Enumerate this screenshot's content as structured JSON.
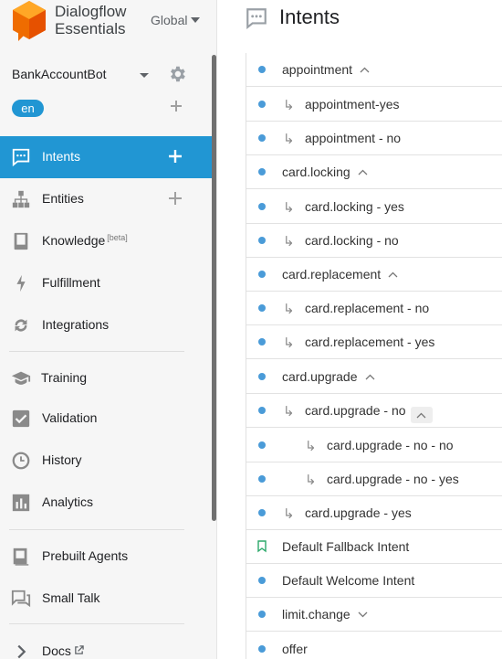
{
  "app": {
    "brand_line1": "Dialogflow",
    "brand_line2": "Essentials",
    "region": "Global"
  },
  "agent": {
    "name": "BankAccountBot",
    "language": "en"
  },
  "sidebar": {
    "items": [
      {
        "label": "Intents",
        "icon": "chat-icon",
        "active": true
      },
      {
        "label": "Entities",
        "icon": "hierarchy-icon"
      },
      {
        "label": "Knowledge",
        "beta": "[beta]",
        "icon": "book-icon"
      },
      {
        "label": "Fulfillment",
        "icon": "bolt-icon"
      },
      {
        "label": "Integrations",
        "icon": "sync-icon"
      },
      {
        "label": "Training",
        "icon": "graduation-cap-icon"
      },
      {
        "label": "Validation",
        "icon": "checkbox-icon"
      },
      {
        "label": "History",
        "icon": "clock-icon"
      },
      {
        "label": "Analytics",
        "icon": "bar-chart-icon"
      },
      {
        "label": "Prebuilt Agents",
        "icon": "prebuilt-icon"
      },
      {
        "label": "Small Talk",
        "icon": "chat-bubbles-icon"
      },
      {
        "label": "Docs",
        "icon": "chevron-right-icon"
      }
    ]
  },
  "header": {
    "title": "Intents"
  },
  "intents": [
    {
      "label": "appointment",
      "level": 0
    },
    {
      "label": "appointment-yes",
      "level": 1
    },
    {
      "label": "appointment - no",
      "level": 1
    },
    {
      "label": "card.locking",
      "level": 0
    },
    {
      "label": "card.locking - yes",
      "level": 1
    },
    {
      "label": "card.locking - no",
      "level": 1
    },
    {
      "label": "card.replacement",
      "level": 0
    },
    {
      "label": "card.replacement - no",
      "level": 1
    },
    {
      "label": "card.replacement - yes",
      "level": 1
    },
    {
      "label": "card.upgrade",
      "level": 0
    },
    {
      "label": "card.upgrade - no",
      "level": 1
    },
    {
      "label": "card.upgrade - no - no",
      "level": 2
    },
    {
      "label": "card.upgrade - no - yes",
      "level": 2
    },
    {
      "label": "card.upgrade - yes",
      "level": 1
    },
    {
      "label": "Default Fallback Intent",
      "level": 0
    },
    {
      "label": "Default Welcome Intent",
      "level": 0
    },
    {
      "label": "limit.change",
      "level": 0
    },
    {
      "label": "offer",
      "level": 0
    }
  ],
  "colors": {
    "accent": "#2196d3",
    "dot": "#4a9bd8",
    "fallback": "#2ba86a"
  }
}
